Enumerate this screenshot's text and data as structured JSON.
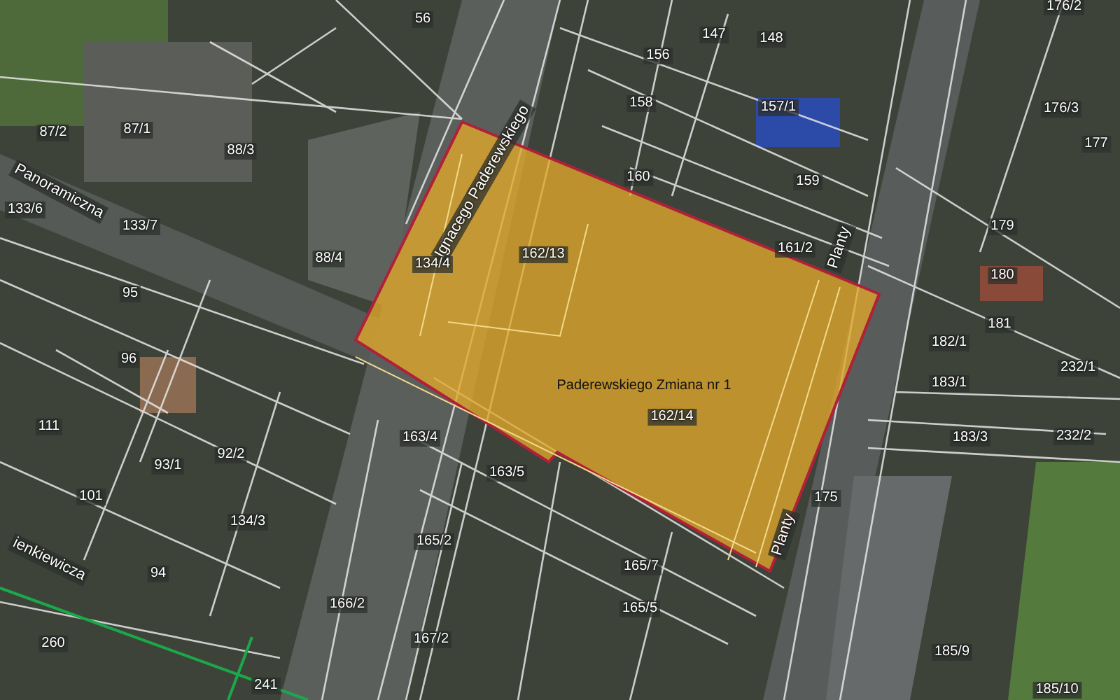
{
  "map": {
    "highlighted_parcel": {
      "label": "Paderewskiego Zmiana  nr 1"
    },
    "streets": [
      "Ignacego Paderewskiego",
      "Panoramiczna",
      "Planty",
      "Planty",
      "ienkiewicza"
    ],
    "parcel_labels": [
      "56",
      "87/2",
      "87/1",
      "88/3",
      "133/6",
      "133/7",
      "88/4",
      "95",
      "134/4",
      "162/13",
      "147",
      "148",
      "156",
      "158",
      "157/1",
      "160",
      "159",
      "161/2",
      "176/2",
      "176/3",
      "177",
      "179",
      "180",
      "181",
      "182/1",
      "183/1",
      "183/3",
      "232/1",
      "232/2",
      "162/14",
      "175",
      "185/9",
      "185/10",
      "96",
      "111",
      "93/1",
      "92/2",
      "101",
      "134/3",
      "94",
      "163/4",
      "163/5",
      "165/2",
      "165/7",
      "165/5",
      "166/2",
      "167/2",
      "260",
      "241"
    ]
  }
}
